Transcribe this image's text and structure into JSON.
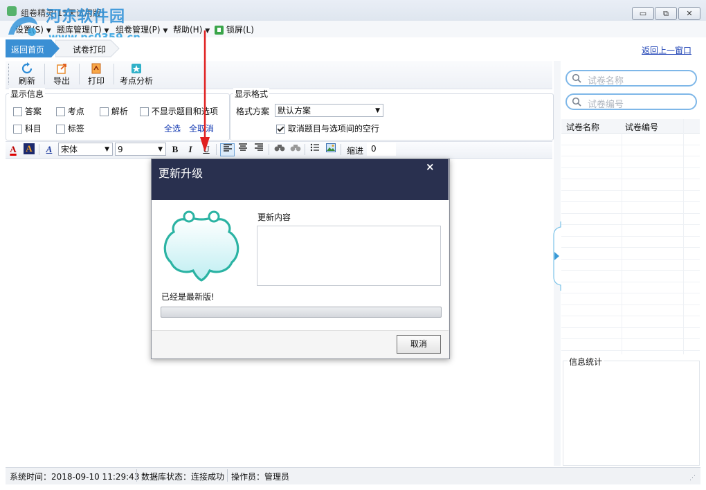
{
  "window": {
    "title": "组卷精灵(15天试用版)",
    "minimize_glyph": "▭",
    "restore_glyph": "⧉",
    "close_glyph": "✕"
  },
  "watermark": {
    "line1": "河东软件园",
    "line2": "www.pc0359.cn"
  },
  "menu": {
    "items": [
      {
        "label": "设置(S)"
      },
      {
        "label": "题库管理(T)"
      },
      {
        "label": "组卷管理(P)"
      },
      {
        "label": "帮助(H)"
      },
      {
        "label": "锁屏(L)"
      }
    ]
  },
  "nav": {
    "tabs": [
      {
        "label": "返回首页"
      },
      {
        "label": "试卷打印"
      }
    ],
    "back_link": "返回上一窗口"
  },
  "toolbar": {
    "buttons": [
      {
        "label": "刷新",
        "icon": "refresh-icon"
      },
      {
        "label": "导出",
        "icon": "export-icon"
      },
      {
        "label": "打印",
        "icon": "print-icon"
      },
      {
        "label": "考点分析",
        "icon": "analysis-icon"
      }
    ]
  },
  "display_info": {
    "title": "显示信息",
    "checkboxes": [
      {
        "label": "答案",
        "checked": false
      },
      {
        "label": "考点",
        "checked": false
      },
      {
        "label": "解析",
        "checked": false
      },
      {
        "label": "不显示题目和选项",
        "checked": false
      },
      {
        "label": "科目",
        "checked": false
      },
      {
        "label": "标签",
        "checked": false
      }
    ],
    "select_all": "全选",
    "deselect_all": "全取消"
  },
  "display_format": {
    "title": "显示格式",
    "scheme_label": "格式方案",
    "scheme_value": "默认方案",
    "remove_blank_label": "取消题目与选项间的空行",
    "remove_blank_checked": true
  },
  "format_bar": {
    "font": "宋体",
    "size": "9",
    "bold": "B",
    "italic": "I",
    "underline": "U",
    "indent_label": "缩进",
    "indent_value": "0"
  },
  "right_panel": {
    "search_name_placeholder": "试卷名称",
    "search_code_placeholder": "试卷编号",
    "columns": [
      "试卷名称",
      "试卷编号"
    ],
    "stats_title": "信息统计"
  },
  "status": {
    "time": "系统时间：2018-09-10 11:29:43",
    "db": "数据库状态：连接成功",
    "operator": "操作员：管理员"
  },
  "dialog": {
    "title": "更新升级",
    "close": "×",
    "content_label": "更新内容",
    "status_text": "已经是最新版!",
    "progress": 0,
    "cancel": "取消"
  },
  "colors": {
    "dialog_header": "#29304f",
    "tab_active": "#3a8fd4",
    "link": "#1a3fb4",
    "mascot": "#2bb3a3",
    "arrow": "#e02020"
  }
}
